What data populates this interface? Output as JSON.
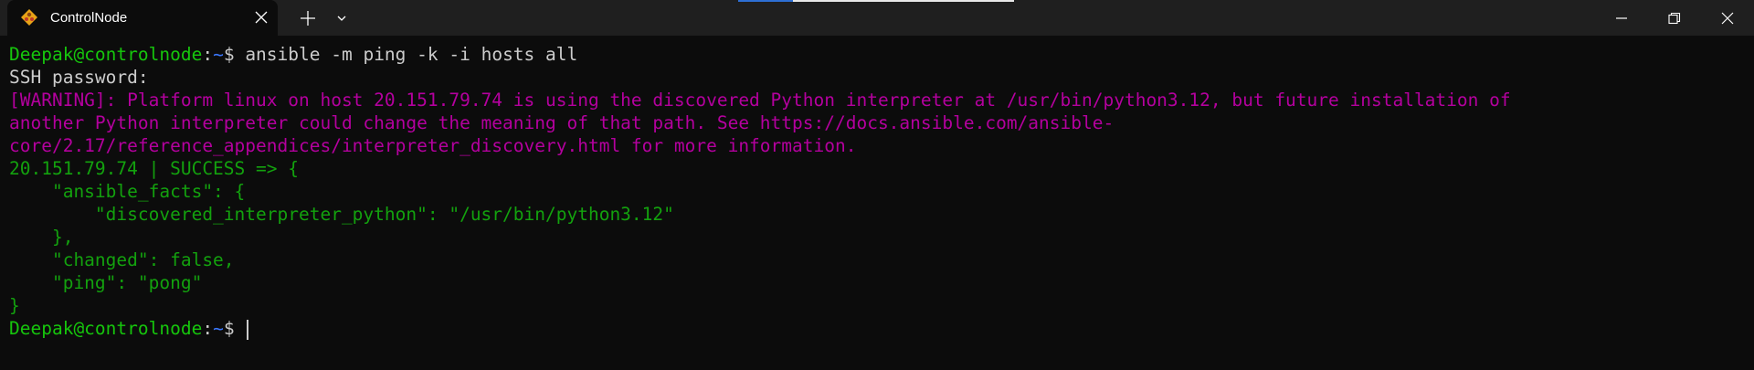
{
  "window": {
    "tab_title": "ControlNode",
    "icons": {
      "tab": "ubuntu-penguin-icon",
      "close_tab": "close-icon",
      "new_tab": "plus-icon",
      "dropdown": "chevron-down-icon",
      "minimize": "minimize-icon",
      "maximize": "restore-icon",
      "close_window": "close-icon"
    }
  },
  "colors": {
    "background": "#0c0c0c",
    "titlebar": "#1f1f1f",
    "prompt_user": "#16c60c",
    "prompt_path": "#3b78ff",
    "warning": "#b4009e",
    "success": "#13a10e",
    "text": "#cccccc"
  },
  "terminal": {
    "prompt_user": "Deepak@controlnode",
    "prompt_sep": ":",
    "prompt_path": "~",
    "prompt_symbol": "$ ",
    "command": "ansible -m ping -k -i hosts all",
    "ssh_prompt": "SSH password:",
    "warning_lines": [
      "[WARNING]: Platform linux on host 20.151.79.74 is using the discovered Python interpreter at /usr/bin/python3.12, but future installation of",
      "another Python interpreter could change the meaning of that path. See https://docs.ansible.com/ansible-",
      "core/2.17/reference_appendices/interpreter_discovery.html for more information."
    ],
    "result_lines": [
      "20.151.79.74 | SUCCESS => {",
      "    \"ansible_facts\": {",
      "        \"discovered_interpreter_python\": \"/usr/bin/python3.12\"",
      "    },",
      "    \"changed\": false,",
      "    \"ping\": \"pong\"",
      "}"
    ]
  }
}
